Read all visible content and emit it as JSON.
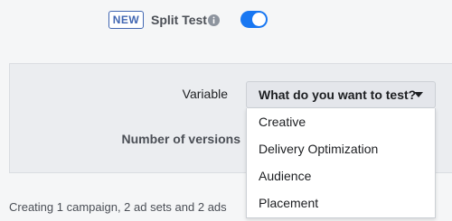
{
  "split_test": {
    "badge": "NEW",
    "label": "Split Test",
    "info_icon": "info-circle-icon",
    "toggle_state": "on",
    "accent_color": "#1877f2"
  },
  "variable": {
    "label": "Variable",
    "select_label": "What do you want to test?",
    "options": [
      "Creative",
      "Delivery Optimization",
      "Audience",
      "Placement"
    ]
  },
  "versions": {
    "label": "Number of versions"
  },
  "footer": {
    "summary": "Creating 1 campaign, 2 ad sets and 2 ads"
  }
}
